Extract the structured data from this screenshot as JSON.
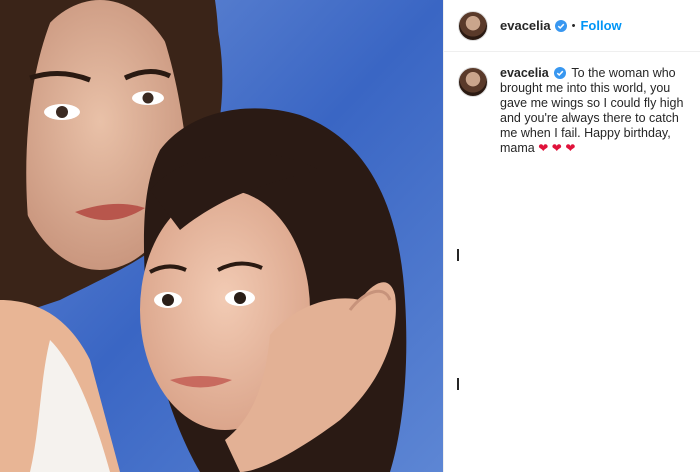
{
  "post": {
    "image_alt": "Mother and daughter portrait",
    "author": {
      "username": "evacelia",
      "verified": true,
      "separator": "•",
      "follow_label": "Follow"
    },
    "caption": {
      "username": "evacelia",
      "text": "To the woman who brought me into this world, you gave me wings so I could fly high and you're always there to catch me when I fail. Happy birthday, mama",
      "hearts": [
        "❤",
        "❤",
        "❤"
      ]
    }
  },
  "colors": {
    "follow": "#0095f6",
    "verified": "#3897f0",
    "heart": "#e0123a",
    "background_blue": "#3a6bc6"
  },
  "icons": [
    "verified-badge-icon",
    "heart-emoji-icon"
  ]
}
